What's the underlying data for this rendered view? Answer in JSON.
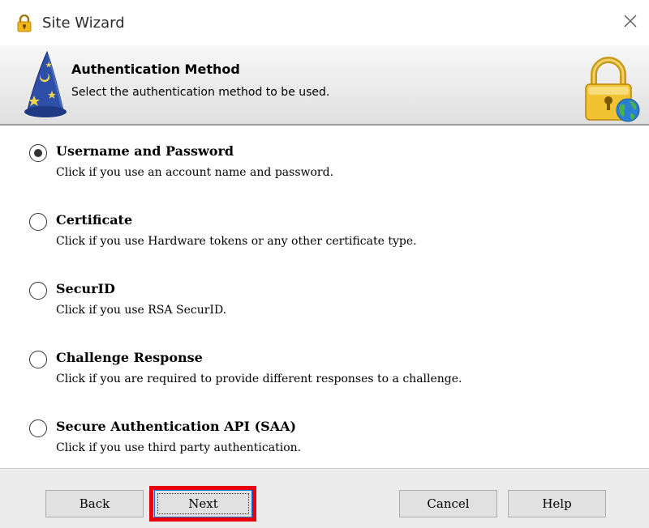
{
  "window": {
    "title": "Site Wizard",
    "close_symbol": "✕",
    "title_icon": "padlock-icon"
  },
  "header": {
    "title": "Authentication Method",
    "subtitle": "Select the authentication method to be used.",
    "left_icon": "wizard-hat-icon",
    "right_icon": "padlock-globe-icon"
  },
  "options": [
    {
      "label": "Username and Password",
      "description": "Click if you use an account name and password.",
      "selected": true
    },
    {
      "label": "Certificate",
      "description": "Click if you use Hardware tokens or any other certificate type.",
      "selected": false
    },
    {
      "label": "SecurID",
      "description": "Click if you use RSA SecurID.",
      "selected": false
    },
    {
      "label": "Challenge Response",
      "description": "Click if you are required to provide different responses to a challenge.",
      "selected": false
    },
    {
      "label": "Secure Authentication API (SAA)",
      "description": "Click if you use third party authentication.",
      "selected": false
    }
  ],
  "buttons": {
    "back": "Back",
    "next": "Next",
    "cancel": "Cancel",
    "help": "Help"
  },
  "colors": {
    "highlight": "#e8000b",
    "header_gradient_top": "#f7f7f7",
    "header_gradient_bottom": "#e0e0e0"
  }
}
